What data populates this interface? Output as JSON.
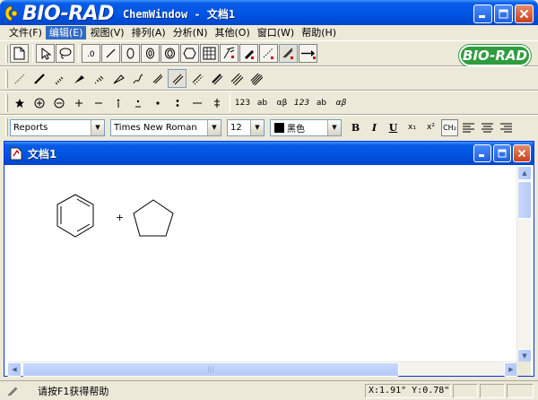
{
  "app": {
    "brand": "BIO-RAD",
    "window_title": "ChemWindow - 文档1",
    "badge": "BIO-RAD"
  },
  "menu": [
    {
      "label": "文件(F)"
    },
    {
      "label": "编辑(E)"
    },
    {
      "label": "视图(V)"
    },
    {
      "label": "排列(A)"
    },
    {
      "label": "分析(N)"
    },
    {
      "label": "其他(O)"
    },
    {
      "label": "窗口(W)"
    },
    {
      "label": "帮助(H)"
    }
  ],
  "toolbar3": {
    "labels": [
      "123",
      "ab",
      "αβ",
      "123",
      "ab",
      "αβ"
    ]
  },
  "format": {
    "style": "Reports",
    "font": "Times New Roman",
    "size": "12",
    "color_label": "黑色",
    "bold": "B",
    "italic": "I",
    "underline": "U",
    "subscript": "x₁",
    "superscript": "x²",
    "formula": "CH₂"
  },
  "document": {
    "title": "文档1",
    "reaction_plus": "+"
  },
  "status": {
    "message": "请按F1获得帮助",
    "coords": "X:1.91\" Y:0.78\""
  },
  "colors": {
    "titlebar": "#0055e5",
    "badge": "#2f9d3e",
    "menu_highlight": "#316ac5"
  }
}
